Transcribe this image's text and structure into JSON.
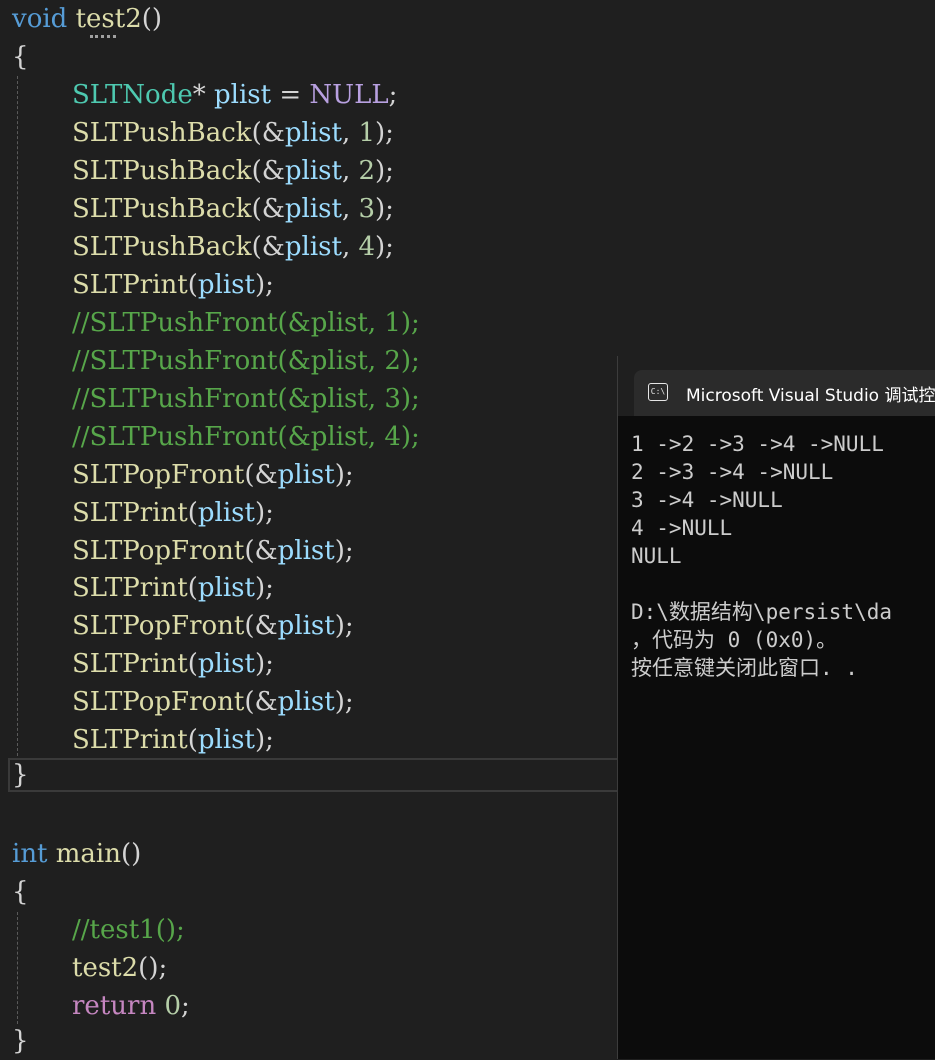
{
  "editor": {
    "func1_keyword": "void",
    "func1_name": "test2",
    "func1_parens": "()",
    "open_brace": "{",
    "close_brace": "}",
    "l_decl_type": "SLTNode",
    "l_decl_rest1": "* ",
    "l_decl_var": "plist",
    "l_decl_eq": " = ",
    "l_decl_null": "NULL",
    "l_decl_end": ";",
    "push_back_fn": "SLTPushBack",
    "print_fn": "SLTPrint",
    "pop_front_fn": "SLTPopFront",
    "arg_ref": "(&",
    "arg_open": "(",
    "arg_var": "plist",
    "arg_comma": ", ",
    "arg_close": ");",
    "nums": [
      "1",
      "2",
      "3",
      "4"
    ],
    "comments": [
      "//SLTPushFront(&plist, 1);",
      "//SLTPushFront(&plist, 2);",
      "//SLTPushFront(&plist, 3);",
      "//SLTPushFront(&plist, 4);"
    ],
    "func2_keyword": "int",
    "func2_name": "main",
    "func2_parens": "()",
    "main_comment": "//test1();",
    "main_call": "test2",
    "main_call_rest": "();",
    "return_kw": "return",
    "return_val": "0",
    "return_end": ";"
  },
  "console": {
    "icon_label": "C:\\",
    "title": "Microsoft Visual Studio 调试控",
    "lines": [
      "1 ->2 ->3 ->4 ->NULL",
      "2 ->3 ->4 ->NULL",
      "3 ->4 ->NULL",
      "4 ->NULL",
      "NULL",
      "",
      "D:\\数据结构\\persist\\da",
      "，代码为 0 (0x0)。",
      "按任意键关闭此窗口. ."
    ]
  },
  "colors": {
    "background": "#1f1f1f",
    "keyword": "#569cd6",
    "control_keyword": "#c586c0",
    "type": "#4ec9b0",
    "function": "#dcdcaa",
    "variable": "#9cdcfe",
    "number": "#b5cea8",
    "comment": "#57a64a",
    "console_bg": "#0c0c0c"
  }
}
